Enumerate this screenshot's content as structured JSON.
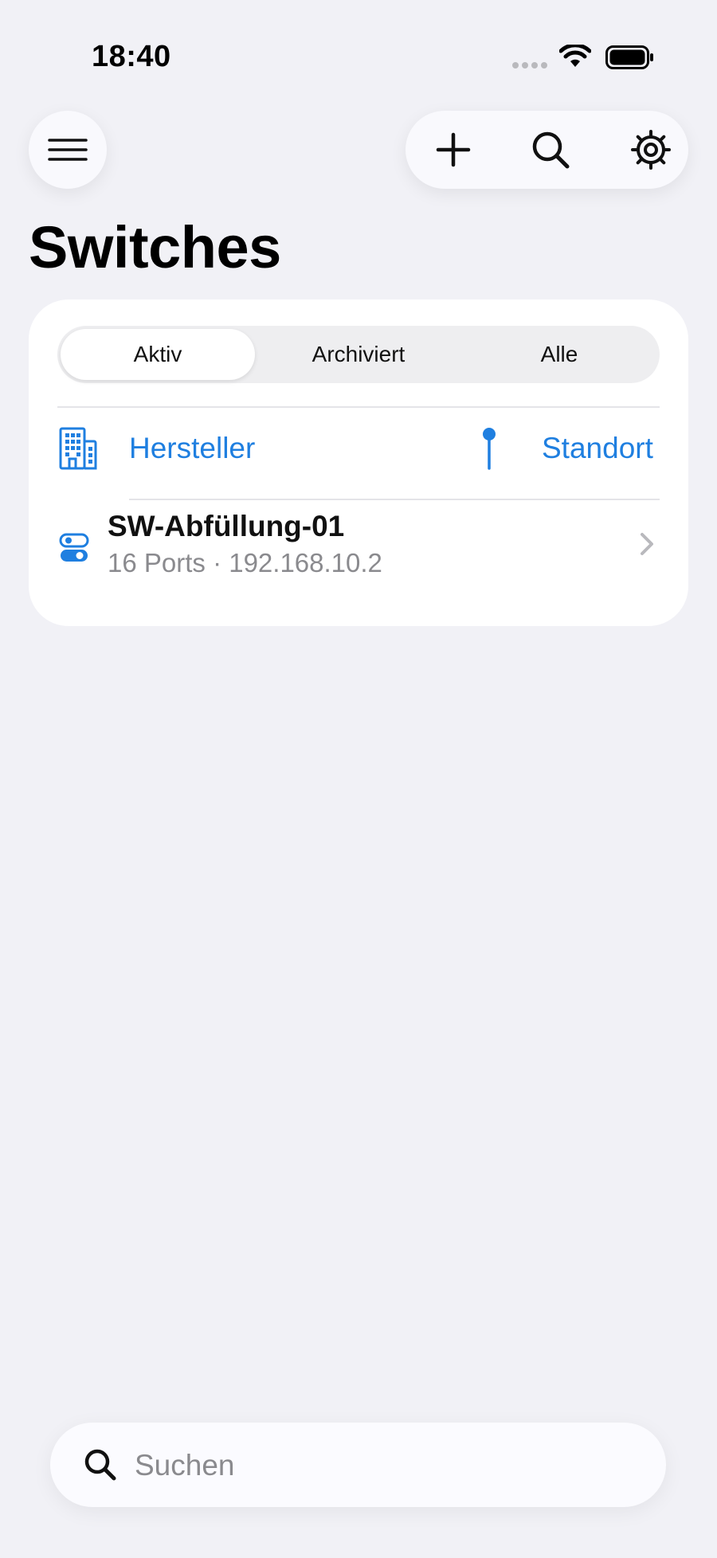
{
  "status_bar": {
    "time": "18:40",
    "icons": [
      "cellular-signal-icon",
      "wifi-icon",
      "battery-icon"
    ]
  },
  "nav": {
    "menu_icon": "hamburger-menu-icon",
    "actions": [
      "plus-icon",
      "search-icon",
      "gear-icon"
    ]
  },
  "page": {
    "title": "Switches"
  },
  "segments": {
    "items": [
      "Aktiv",
      "Archiviert",
      "Alle"
    ],
    "selected": "Aktiv"
  },
  "filters": {
    "manufacturer": {
      "label": "Hersteller",
      "icon": "building-icon"
    },
    "location": {
      "label": "Standort",
      "icon": "pin-icon"
    }
  },
  "switches": [
    {
      "name": "SW-Abfüllung-01",
      "details": "16 Ports · 192.168.10.2",
      "icon": "toggle-switch-icon"
    }
  ],
  "search": {
    "placeholder": "Suchen",
    "value": ""
  },
  "colors": {
    "background": "#f1f1f6",
    "accent": "#1f7fe0",
    "secondary_text": "#8a8a8e"
  }
}
